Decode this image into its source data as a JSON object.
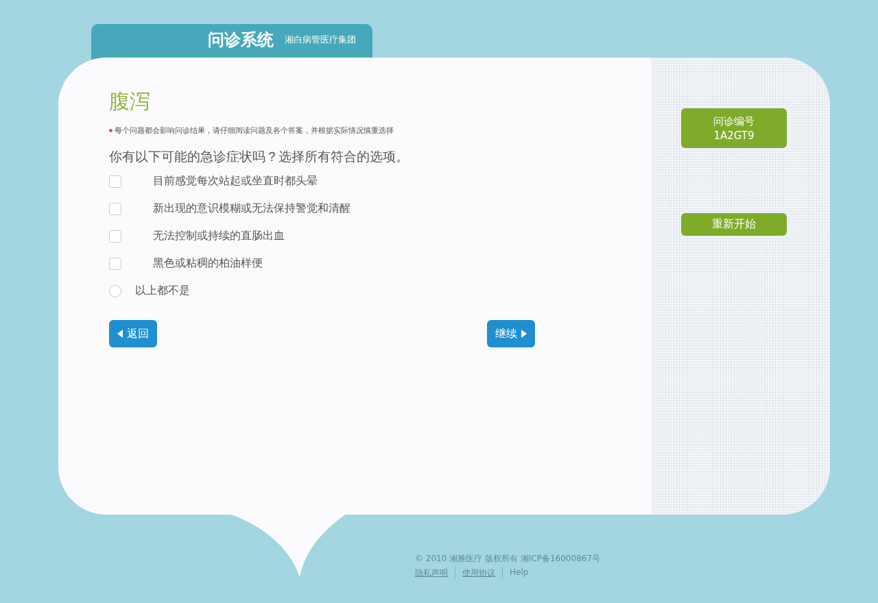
{
  "header": {
    "title": "问诊系统",
    "subtitle": "湘白病管医疗集团"
  },
  "page": {
    "title": "腹泻",
    "notice": "每个问题都会影响问诊结果，请仔细阅读问题及各个答案，并根据实际情况慎重选择",
    "question": "你有以下可能的急诊症状吗？选择所有符合的选项。"
  },
  "options": [
    {
      "kind": "checkbox",
      "label": "目前感觉每次站起或坐直时都头晕",
      "checked": false
    },
    {
      "kind": "checkbox",
      "label": "新出现的意识模糊或无法保持警觉和清醒",
      "checked": false
    },
    {
      "kind": "checkbox",
      "label": "无法控制或持续的直肠出血",
      "checked": false
    },
    {
      "kind": "checkbox",
      "label": "黑色或粘稠的柏油样便",
      "checked": false
    },
    {
      "kind": "radio",
      "label": "以上都不是",
      "checked": false
    }
  ],
  "nav": {
    "back": "返回",
    "next": "继续"
  },
  "sidebar": {
    "code_label": "问诊编号",
    "code": "1A2GT9",
    "restart": "重新开始"
  },
  "footer": {
    "copyright": "© 2010 湘雅医疗 版权所有 湘ICP备16000867号",
    "links": [
      "隐私声明",
      "使用协议",
      "Help"
    ]
  }
}
